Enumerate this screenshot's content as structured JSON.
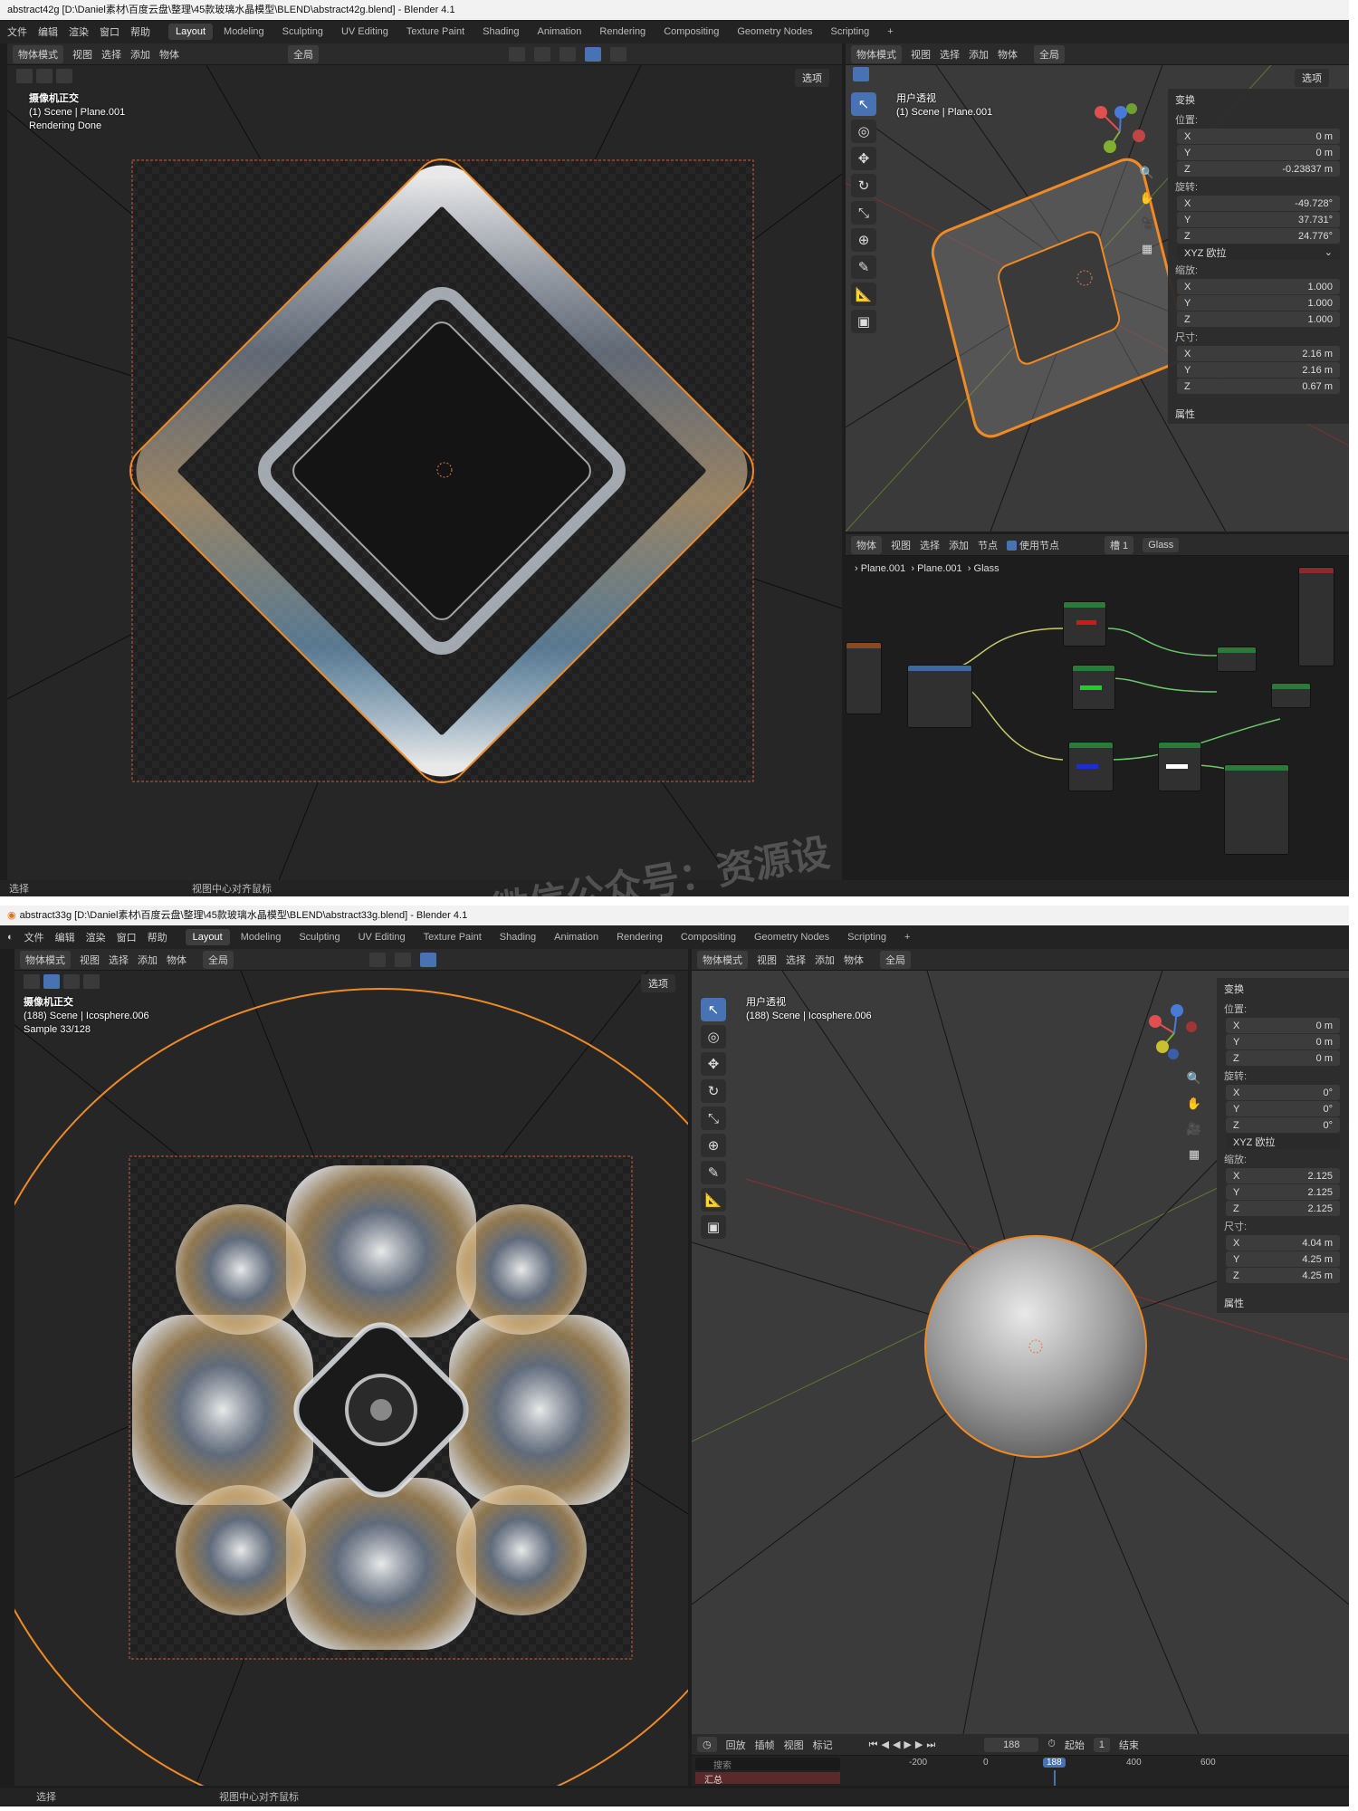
{
  "win1": {
    "title": "abstract42g [D:\\Daniel素材\\百度云盘\\整理\\45款玻璃水晶模型\\BLEND\\abstract42g.blend] - Blender 4.1",
    "menus": [
      "文件",
      "编辑",
      "渲染",
      "窗口",
      "帮助"
    ],
    "workspaces": [
      "Layout",
      "Modeling",
      "Sculpting",
      "UV Editing",
      "Texture Paint",
      "Shading",
      "Animation",
      "Rendering",
      "Compositing",
      "Geometry Nodes",
      "Scripting",
      "+"
    ],
    "left_header": {
      "mode": "物体模式",
      "menu": [
        "视图",
        "选择",
        "添加",
        "物体"
      ],
      "transform": "全局"
    },
    "options_label": "选项",
    "left_overlay": [
      "摄像机正交",
      "(1) Scene | Plane.001",
      "Rendering Done"
    ],
    "right_header": {
      "mode": "物体模式",
      "menu": [
        "视图",
        "选择",
        "添加",
        "物体"
      ],
      "transform": "全局"
    },
    "right_overlay": [
      "用户透视",
      "(1) Scene | Plane.001"
    ],
    "npanel": {
      "section": "变换",
      "loc_label": "位置:",
      "loc": [
        [
          "X",
          "0 m"
        ],
        [
          "Y",
          "0 m"
        ],
        [
          "Z",
          "-0.23837 m"
        ]
      ],
      "rot_label": "旋转:",
      "rot": [
        [
          "X",
          "-49.728°"
        ],
        [
          "Y",
          "37.731°"
        ],
        [
          "Z",
          "24.776°"
        ]
      ],
      "mode": "XYZ 欧拉",
      "scale_label": "缩放:",
      "scale": [
        [
          "X",
          "1.000"
        ],
        [
          "Y",
          "1.000"
        ],
        [
          "Z",
          "1.000"
        ]
      ],
      "dim_label": "尺寸:",
      "dim": [
        [
          "X",
          "2.16 m"
        ],
        [
          "Y",
          "2.16 m"
        ],
        [
          "Z",
          "0.67 m"
        ]
      ],
      "props": "属性"
    },
    "node_header": {
      "type": "物体",
      "menu": [
        "视图",
        "选择",
        "添加",
        "节点"
      ],
      "use_nodes": "使用节点",
      "slot": "槽 1",
      "material": "Glass"
    },
    "breadcrumb": [
      "Plane.001",
      "Plane.001",
      "Glass"
    ],
    "status": [
      "选择",
      "视图中心对齐鼠标"
    ]
  },
  "win2": {
    "title": "abstract33g [D:\\Daniel素材\\百度云盘\\整理\\45款玻璃水晶模型\\BLEND\\abstract33g.blend] - Blender 4.1",
    "menus": [
      "文件",
      "编辑",
      "渲染",
      "窗口",
      "帮助"
    ],
    "workspaces": [
      "Layout",
      "Modeling",
      "Sculpting",
      "UV Editing",
      "Texture Paint",
      "Shading",
      "Animation",
      "Rendering",
      "Compositing",
      "Geometry Nodes",
      "Scripting",
      "+"
    ],
    "left_header": {
      "mode": "物体模式",
      "menu": [
        "视图",
        "选择",
        "添加",
        "物体"
      ],
      "transform": "全局"
    },
    "options_label": "选项",
    "left_overlay": [
      "摄像机正交",
      "(188) Scene | Icosphere.006",
      "Sample 33/128"
    ],
    "right_header": {
      "mode": "物体模式",
      "menu": [
        "视图",
        "选择",
        "添加",
        "物体"
      ],
      "transform": "全局"
    },
    "right_overlay": [
      "用户透视",
      "(188) Scene | Icosphere.006"
    ],
    "npanel": {
      "section": "变换",
      "loc_label": "位置:",
      "loc": [
        [
          "X",
          "0 m"
        ],
        [
          "Y",
          "0 m"
        ],
        [
          "Z",
          "0 m"
        ]
      ],
      "rot_label": "旋转:",
      "rot": [
        [
          "X",
          "0°"
        ],
        [
          "Y",
          "0°"
        ],
        [
          "Z",
          "0°"
        ]
      ],
      "mode": "XYZ 欧拉",
      "scale_label": "缩放:",
      "scale": [
        [
          "X",
          "2.125"
        ],
        [
          "Y",
          "2.125"
        ],
        [
          "Z",
          "2.125"
        ]
      ],
      "dim_label": "尺寸:",
      "dim": [
        [
          "X",
          "4.04 m"
        ],
        [
          "Y",
          "4.25 m"
        ],
        [
          "Z",
          "4.25 m"
        ]
      ],
      "props": "属性"
    },
    "timeline": {
      "menu": [
        "回放",
        "插帧",
        "视图",
        "标记"
      ],
      "frame": "188",
      "start_label": "起始",
      "start": "1",
      "end_label": "结束",
      "search_placeholder": "搜索",
      "summary": "汇总",
      "ticks": [
        "-200",
        "0",
        "188",
        "400",
        "600"
      ]
    },
    "status": [
      "选择",
      "视图中心对齐鼠标"
    ]
  },
  "watermark": "微信公众号：资源设",
  "colors": {
    "accent": "#4772b3",
    "selection": "#f08a24",
    "bg": "#1d1d1d",
    "panel": "#2b2b2b"
  }
}
